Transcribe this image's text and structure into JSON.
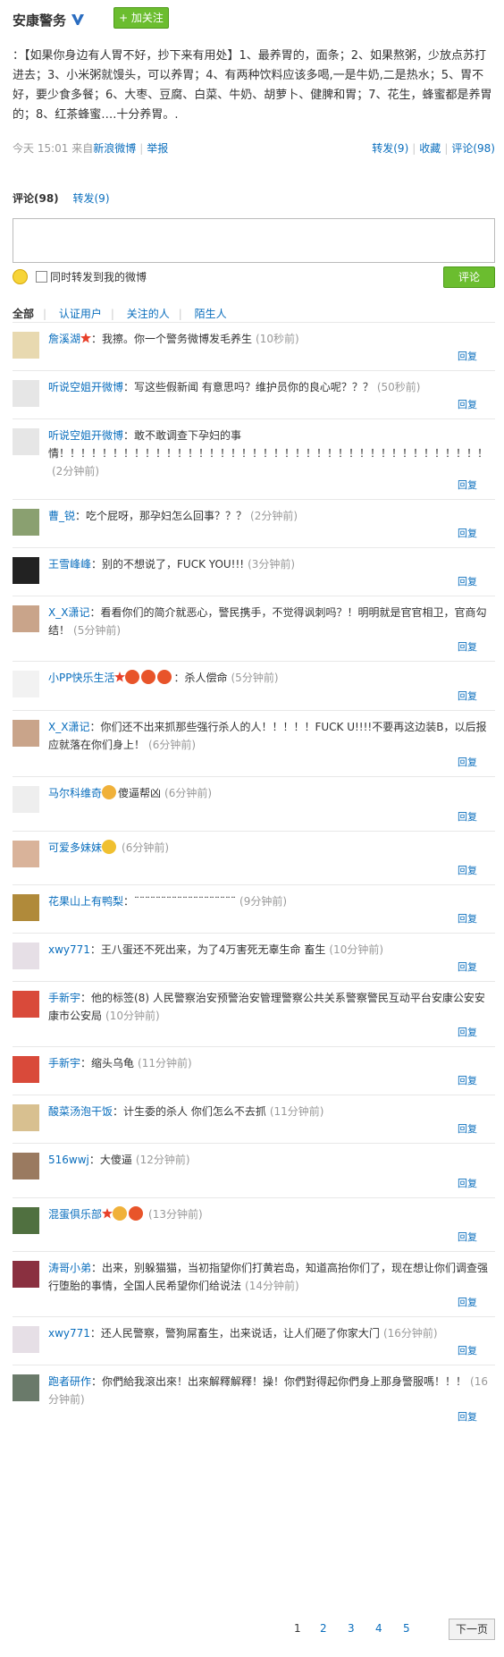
{
  "post": {
    "author": "安康警务",
    "verified": true,
    "follow_label": "+ 加关注",
    "body": "：【如果你身边有人胃不好，抄下来有用处】1、最养胃的，面条；2、如果熬粥，少放点苏打进去；3、小米粥就馒头，可以养胃；4、有两种饮料应该多喝,一是牛奶,二是热水；5、胃不好，要少食多餐；6、大枣、豆腐、白菜、牛奶、胡萝卜、健脾和胃；7、花生，蜂蜜都是养胃的；8、红茶蜂蜜….十分养胃。.",
    "time_prefix": "今天 15:01 来自",
    "source": "新浪微博",
    "report": "举报",
    "repost": "转发(9)",
    "favorite": "收藏",
    "comment": "评论(98)"
  },
  "comment_tabs": {
    "comments": "评论(98)",
    "reposts": "转发(9)"
  },
  "composer": {
    "also_repost": "同时转发到我的微博",
    "submit": "评论"
  },
  "filters": [
    "全部",
    "认证用户",
    "关注的人",
    "陌生人"
  ],
  "reply_label": "回复",
  "comments": [
    {
      "user": "詹溪湖",
      "star": true,
      "text": "：我擦。你一个警务微博发毛养生",
      "time": "(10秒前)",
      "avatar": "#e8d9b0",
      "height": 53
    },
    {
      "user": "听说空姐开微博",
      "text": "：写这些假新闻 有意思吗？维护员你的良心呢？？？",
      "time": "(50秒前)",
      "avatar": "#e6e6e6",
      "height": 53
    },
    {
      "user": "听说空姐开微博",
      "text": "：敢不敢调查下孕妇的事情！！！！！！！！！！！！！！！！！！！！！！！！！！！！！！！！！！！！！！！！",
      "time": "(2分钟前)",
      "avatar": "#e6e6e6",
      "height": 89
    },
    {
      "user": "曹_锐",
      "text": "：吃个屁呀，那孕妇怎么回事？？？",
      "time": "(2分钟前)",
      "avatar": "#8aa070",
      "height": 53
    },
    {
      "user": "王雪峰峰",
      "text": "：别的不想说了，FUCK YOU!!!",
      "time": "(3分钟前)",
      "avatar": "#222222",
      "height": 53
    },
    {
      "user": "X_X潇记",
      "text": "：看看你们的简介就恶心，警民携手，不觉得讽刺吗？！明明就是官官相卫，官商勾结！",
      "time": "(5分钟前)",
      "avatar": "#c9a48a",
      "height": 72
    },
    {
      "user": "小PP快乐生活",
      "star": true,
      "text": "：杀人偿命",
      "emoji": [
        "#e8542a",
        "#e8542a",
        "#e8542a"
      ],
      "time": "(5分钟前)",
      "avatar": "#f2f2f2",
      "height": 54
    },
    {
      "user": "X_X潇记",
      "text": "：你们还不出来抓那些强行杀人的人！！！！！FUCK U!!!!不要再这边装B，以后报应就落在你们身上！",
      "time": "(6分钟前)",
      "avatar": "#c9a48a",
      "height": 73
    },
    {
      "user": "马尔科维奇",
      "emoji": [
        "#f0b13a"
      ],
      "text": "傻逼帮凶",
      "time": "(6分钟前)",
      "avatar": "#eeeeee",
      "height": 60
    },
    {
      "user": "可爱多妹妹",
      "emoji": [
        "#f0c030"
      ],
      "text": "",
      "time": "(6分钟前)",
      "avatar": "#d9b39a",
      "height": 59
    },
    {
      "user": "花果山上有鸭梨",
      "text": "：¨¨¨¨¨¨¨¨¨¨¨¨¨¨¨¨¨¨¨",
      "time": "(9分钟前)",
      "avatar": "#b08a3a",
      "height": 53
    },
    {
      "user": "xwy771",
      "text": "：王八蛋还不死出来，为了4万害死无辜生命 畜生",
      "time": "(10分钟前)",
      "avatar": "#e6dfe6",
      "height": 53
    },
    {
      "user": "手新宇",
      "text": "：他的标签(8) 人民警察治安预警治安管理警察公共关系警察警民互动平台安康公安安康市公安局",
      "time": "(10分钟前)",
      "avatar": "#d94a3a",
      "height": 72
    },
    {
      "user": "手新宇",
      "text": "：缩头乌龟",
      "time": "(11分钟前)",
      "avatar": "#d94a3a",
      "height": 53
    },
    {
      "user": "酸菜汤泡干饭",
      "text": "：计生委的杀人 你们怎么不去抓",
      "time": "(11分钟前)",
      "avatar": "#d8c090",
      "height": 53
    },
    {
      "user": "516wwj",
      "text": "：大傻逼",
      "time": "(12分钟前)",
      "avatar": "#9a7a60",
      "height": 60
    },
    {
      "user": "混蛋俱乐部",
      "star": true,
      "emoji": [
        "#f0b13a",
        "#e8542a"
      ],
      "text": "",
      "time": "(13分钟前)",
      "avatar": "#507040",
      "height": 59
    },
    {
      "user": "涛哥小弟",
      "text": "：出来，别躲猫猫，当初指望你们打黄岩岛，知道高抬你们了，现在想让你们调查强行堕胎的事情，全国人民希望你们给说法",
      "time": "(14分钟前)",
      "avatar": "#8a3040",
      "height": 72
    },
    {
      "user": "xwy771",
      "text": "：还人民警察，警狗屌畜生，出来说话，让人们砸了你家大门",
      "time": "(16分钟前)",
      "avatar": "#e6dfe6",
      "height": 53
    },
    {
      "user": "跑者研作",
      "text": "：你們給我滾出來！出來解釋解釋！操！你們對得起你們身上那身警服嗎！！！",
      "time": "(16分钟前)",
      "avatar": "#6a7a6a",
      "height": 73
    }
  ],
  "pagination": {
    "pages": [
      "1",
      "2",
      "3",
      "4",
      "5"
    ],
    "next": "下一页"
  }
}
